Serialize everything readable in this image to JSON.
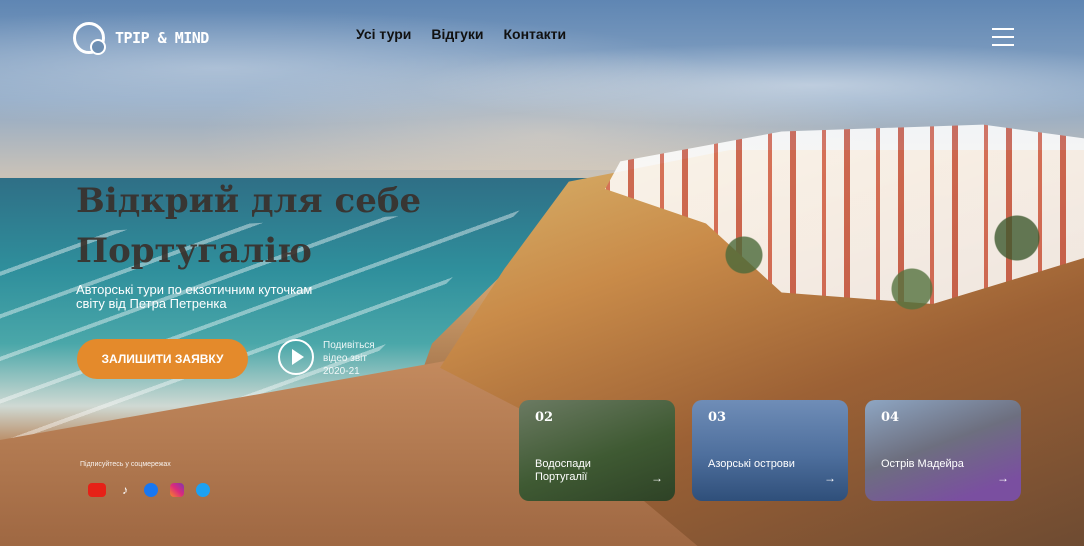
{
  "brand": {
    "name": "TPIP & MIND",
    "logo_icon": "globe-search-icon"
  },
  "nav": {
    "items": [
      "Усі тури",
      "Відгуки",
      "Контакти"
    ]
  },
  "menu_icon": "hamburger-menu-icon",
  "hero": {
    "title_line1": "Відкрий для себе",
    "title_line2": "Португалію",
    "subtitle": "Авторські тури по екзотичним куточкам світу від Петра Петренка",
    "cta_label": "ЗАЛИШИТИ ЗАЯВКУ",
    "video_label": "Подивіться відео звіт 2020-21",
    "colors": {
      "cta": "#e48a2b",
      "title": "#3a2f2a"
    }
  },
  "social": {
    "label": "Підписуйтесь у соцмережах",
    "icons": [
      "youtube-icon",
      "tiktok-icon",
      "facebook-icon",
      "instagram-icon",
      "twitter-icon"
    ]
  },
  "cards": [
    {
      "number": "02",
      "caption": "Водоспади Португалії",
      "arrow": "→"
    },
    {
      "number": "03",
      "caption": "Азорські острови",
      "arrow": "→"
    },
    {
      "number": "04",
      "caption": "Острів Мадейра",
      "arrow": "→"
    }
  ]
}
